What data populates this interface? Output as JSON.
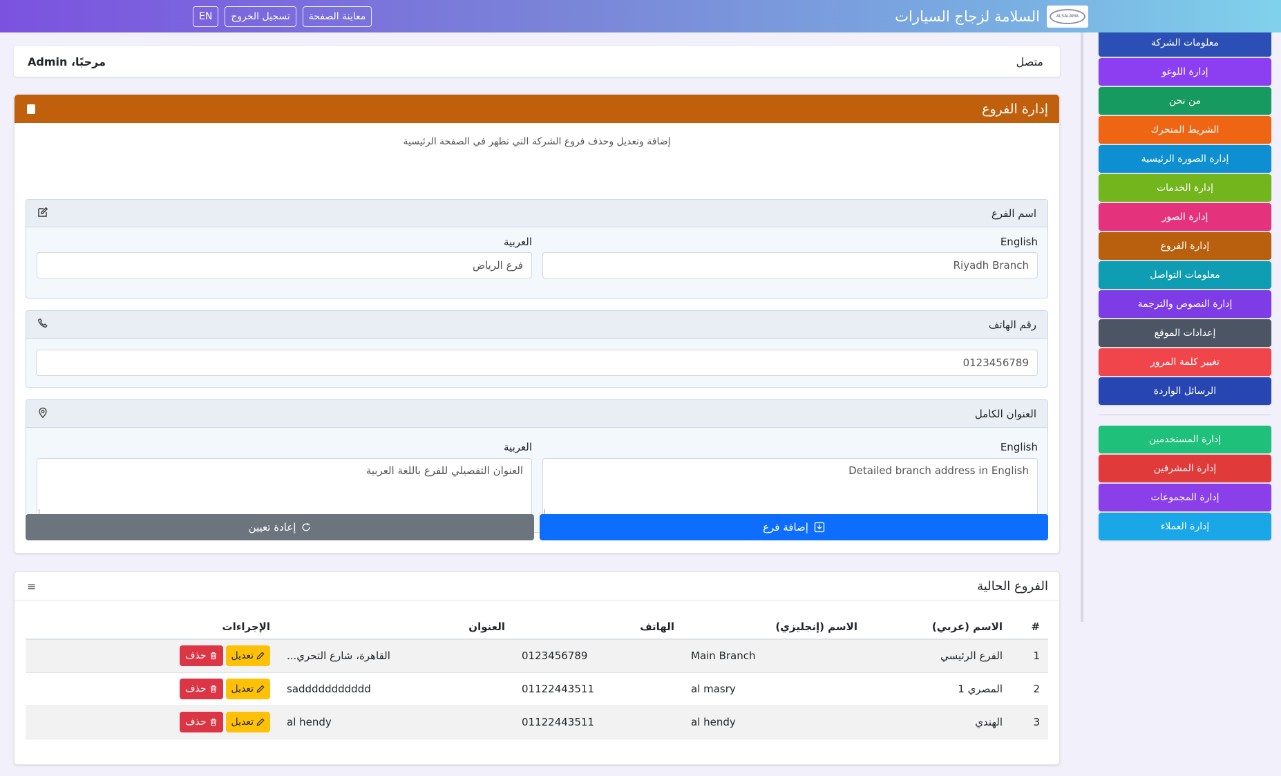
{
  "topbar": {
    "title": "السلامة لزجاج السيارات",
    "logo_text": "ALSALAMA",
    "preview_label": "معاينة الصفحة",
    "logout_label": "تسجيل الخروج",
    "lang_label": "EN"
  },
  "welcome": {
    "status": "متصل",
    "greeting": "مرحبًا، Admin"
  },
  "sidebar": {
    "items": [
      {
        "label": "معلومات الشركة",
        "color": "#2b4fb4"
      },
      {
        "label": "إدارة اللوغو",
        "color": "#8b3ff0"
      },
      {
        "label": "من نحن",
        "color": "#179a5f"
      },
      {
        "label": "الشريط المتحرك",
        "color": "#ee6514"
      },
      {
        "label": "إدارة الصورة الرئيسية",
        "color": "#0d8fd1"
      },
      {
        "label": "إدارة الخدمات",
        "color": "#72b51d"
      },
      {
        "label": "إدارة الصور",
        "color": "#e5327c"
      },
      {
        "label": "إدارة الفروع",
        "color": "#b8600e"
      },
      {
        "label": "معلومات التواصل",
        "color": "#0e9db3"
      },
      {
        "label": "إدارة النصوص والترجمة",
        "color": "#7d3ce6"
      },
      {
        "label": "إعدادات الموقع",
        "color": "#4b5563"
      },
      {
        "label": "تغيير كلمة المرور",
        "color": "#f0454a"
      },
      {
        "label": "الرسائل الواردة",
        "color": "#2746b2"
      },
      {
        "label": "إدارة المستخدمين",
        "color": "#1ec07a"
      },
      {
        "label": "إدارة المشرفين",
        "color": "#e03a3a"
      },
      {
        "label": "إدارة المجموعات",
        "color": "#8a3fe8"
      },
      {
        "label": "إدارة العملاء",
        "color": "#1aa7e8"
      }
    ]
  },
  "branch_form": {
    "title": "إدارة الفروع",
    "description": "إضافة وتعديل وحذف فروع الشركة التي تظهر في الصفحة الرئيسية",
    "name_section": {
      "label": "اسم الفرع",
      "english_label": "English",
      "arabic_label": "العربية",
      "english_value": "Riyadh Branch",
      "arabic_value": "فرع الرياض"
    },
    "phone_section": {
      "label": "رقم الهاتف",
      "value": "0123456789"
    },
    "address_section": {
      "label": "العنوان الكامل",
      "english_label": "English",
      "arabic_label": "العربية",
      "english_value": "Detailed branch address in English",
      "arabic_value": "العنوان التفصيلي للفرع باللغة العربية"
    },
    "add_label": "إضافة فرع",
    "reset_label": "إعادة تعيين"
  },
  "branch_list": {
    "title": "الفروع الحالية",
    "headers": {
      "num": "#",
      "name_ar": "الاسم (عربي)",
      "name_en": "الاسم (إنجليزي)",
      "phone": "الهاتف",
      "address": "العنوان",
      "actions": "الإجراءات"
    },
    "edit_label": "تعديل",
    "delete_label": "حذف",
    "rows": [
      {
        "num": "1",
        "name_ar": "الفرع الرئيسي",
        "name_en": "Main Branch",
        "phone": "0123456789",
        "address": "القاهرة، شارع التحري..."
      },
      {
        "num": "2",
        "name_ar": "المصري 1",
        "name_en": "al masry",
        "phone": "01122443511",
        "address": "saddddddddddd"
      },
      {
        "num": "3",
        "name_ar": "الهندي",
        "name_en": "al hendy",
        "phone": "01122443511",
        "address": "al hendy"
      }
    ]
  }
}
